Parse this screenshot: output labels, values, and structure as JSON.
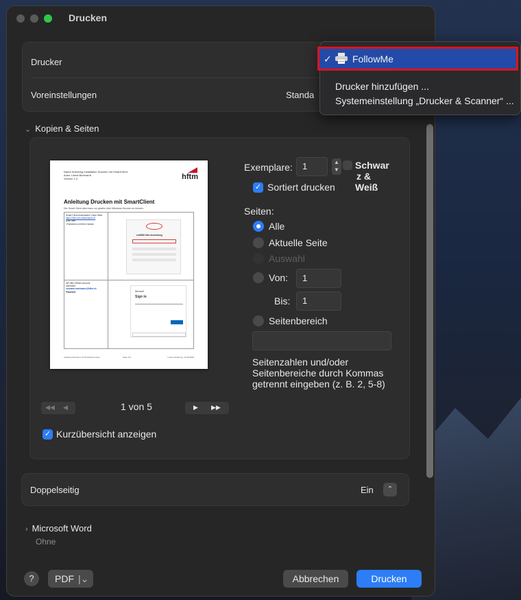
{
  "window": {
    "title": "Drucken"
  },
  "printer_panel": {
    "printer_label": "Drucker",
    "presets_label": "Voreinstellungen",
    "presets_value": "Standa"
  },
  "printer_menu": {
    "selected": "FollowMe",
    "checkmark": "✓",
    "items": [
      "Drucker hinzufügen ...",
      "Systemeinstellung „Drucker & Scanner“ ..."
    ]
  },
  "copies_section": {
    "title": "Kopien & Seiten",
    "copies_label": "Exemplare:",
    "copies_value": "1",
    "bw_label": "Schwar z & Weiß",
    "bw_lines": [
      "Schwar",
      "z &",
      "Weiß"
    ],
    "collate_label": "Sortiert drucken",
    "pages_label": "Seiten:",
    "radio_all": "Alle",
    "radio_current": "Aktuelle Seite",
    "radio_selection": "Auswahl",
    "radio_from": "Von:",
    "from_value": "1",
    "to_label": "Bis:",
    "to_value": "1",
    "radio_range": "Seitenbereich",
    "range_hint_lines": [
      "Seitenzahlen und/oder",
      "Seitenbereiche durch Kommas",
      "getrennt eingeben (z. B. 2, 5-8)"
    ],
    "page_indicator": "1 von 5",
    "thumbnail_label": "Kurzübersicht anzeigen"
  },
  "preview_doc": {
    "meta_lines": [
      "Name     Anleitung Installation Drucken mit SmartClient",
      "Autor    Lineal Burkhardt",
      "Version  1.0"
    ],
    "logo": "hftm",
    "heading": "Anleitung Drucken mit SmartClient",
    "intro": "Der Smart Client dient dazu um gesehn über Windows-Drucken zu können.",
    "col1_lines": [
      "Smart Client downloaden. Dazu Seite:",
      "https://hftm.ws.cofolderprint.ev",
      "q.auf uftm",
      "«Fortfahren mit hftm» klicken"
    ],
    "col2_lines": [
      "IdP-hftm Offices-Account",
      "anmelden:",
      "vorname.nachname@hftm.ch",
      "Passwort"
    ],
    "card1_title": "softIDM hftm Anmeldung",
    "card2_brand": "Microsoft",
    "card2_title": "Sign in",
    "footer_left": "Anleitung Drucken mit SmartClient.docx",
    "footer_mid": "Seite 1/4",
    "footer_right": "Letzte Änderung: 11.09.2020"
  },
  "duplex": {
    "label": "Doppelseitig",
    "value": "Ein"
  },
  "word_section": {
    "title": "Microsoft Word",
    "subtitle": "Ohne"
  },
  "footer": {
    "help": "?",
    "pdf": "PDF",
    "cancel": "Abbrechen",
    "print": "Drucken"
  },
  "colors": {
    "accent": "#2d7df6",
    "highlight_box": "#e0121b",
    "window_bg": "#262626"
  }
}
